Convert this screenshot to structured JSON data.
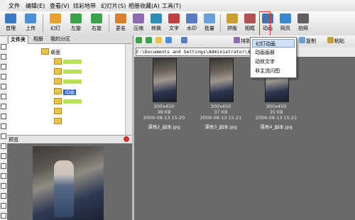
{
  "menu": [
    "文件",
    "编辑(E)",
    "查看(V)",
    "炫彩地带",
    "幻灯片(S)",
    "相册收藏(A)",
    "工具(T)"
  ],
  "toolbar": [
    {
      "label": "首理",
      "icon": "browse-icon",
      "color": "#3c78c8"
    },
    {
      "label": "上传",
      "icon": "upload-icon",
      "color": "#4a90d9"
    },
    {
      "label": "幻灯",
      "icon": "slideshow-icon",
      "color": "#e8a030"
    },
    {
      "label": "左旋",
      "icon": "rotate-left-icon",
      "color": "#3aa34a"
    },
    {
      "label": "右旋",
      "icon": "rotate-right-icon",
      "color": "#3aa34a"
    },
    {
      "label": "更名",
      "icon": "rename-icon",
      "color": "#d9822b"
    },
    {
      "label": "压缩",
      "icon": "compress-icon",
      "color": "#8c6bb0"
    },
    {
      "label": "转换",
      "icon": "convert-icon",
      "color": "#2b8fb5"
    },
    {
      "label": "文字",
      "icon": "text-icon",
      "color": "#c04040"
    },
    {
      "label": "水印",
      "icon": "watermark-icon",
      "color": "#5a7cc0"
    },
    {
      "label": "批量",
      "icon": "batch-icon",
      "color": "#6aa0d8"
    },
    {
      "label": "拼版",
      "icon": "layout-icon",
      "color": "#c8a030"
    },
    {
      "label": "相框",
      "icon": "frame-icon",
      "color": "#b05050"
    },
    {
      "label": "动画",
      "icon": "animation-icon",
      "color": "#4a70b0"
    },
    {
      "label": "网页",
      "icon": "webpage-icon",
      "color": "#3a88d0"
    },
    {
      "label": "拍照",
      "icon": "camera-icon",
      "color": "#606060"
    }
  ],
  "left_tabs": [
    "文件夹",
    "相册",
    "我的分区"
  ],
  "tree": {
    "desktop_label": "桌面",
    "selected_label": "动画"
  },
  "preview_label": "预览",
  "right_toolbar": [
    "排到",
    "复制",
    "粘贴"
  ],
  "address": "C:\\Documents and Settings\\Administrator\\桌",
  "animation_menu": [
    "幻灯动画",
    "动画画册",
    "动效文字",
    "非主流闪图"
  ],
  "thumbnails": [
    {
      "size": "300x450",
      "filesize": "38 KB",
      "date": "2009-08-13 15:20",
      "name": "漂亮2_副本.jpg"
    },
    {
      "size": "300x450",
      "filesize": "37 KB",
      "date": "2009-08-13 15:21",
      "name": "漂亮3_副本.jpg"
    },
    {
      "size": "300x450",
      "filesize": "35 KB",
      "date": "2009-08-13 15:21",
      "name": "漂亮4_副本.jpg"
    }
  ],
  "colors": {
    "selection": "#2b62c6",
    "highlight_box": "#e03030",
    "menu_hover": "#cfe0f7"
  }
}
